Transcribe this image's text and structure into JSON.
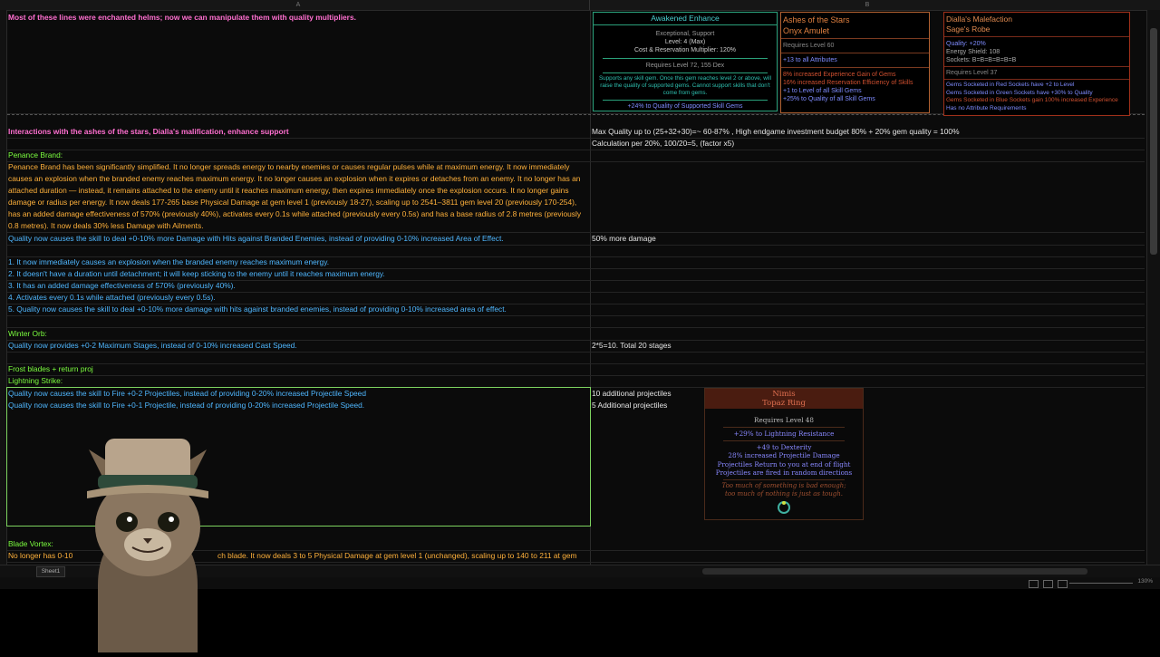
{
  "sheet": {
    "col_a": "A",
    "col_b": "B",
    "tab": "Sheet1",
    "zoom": "130%"
  },
  "rows": {
    "r1_a": "Most of these lines were enchanted helms; now we can manipulate them with quality multipliers.",
    "interactions_a": "Interactions with the ashes of the stars, Dialla's malification, enhance support",
    "interactions_b": "Max Quality up to (25+32+30)=~ 60-87% , High endgame investment budget 80% + 20% gem quality = 100%",
    "calc_b": "Calculation per 20%, 100/20=5, (factor x5)",
    "penance_title": "Penance Brand:",
    "penance_para": "Penance Brand has been significantly simplified. It no longer spreads energy to nearby enemies or causes regular pulses while at maximum energy. It now immediately causes an explosion when the branded enemy reaches maximum energy. It no longer causes an explosion when it expires or detaches from an enemy. It no longer has an attached duration — instead, it remains attached to the enemy until it reaches maximum energy, then expires immediately once the explosion occurs. It no longer gains damage or radius per energy. It now deals 177-265 base Physical Damage at gem level 1 (previously 18-27), scaling up to 2541–3811 gem level 20 (previously 170-254), has an added damage effectiveness of 570% (previously 40%), activates every 0.1s while attached (previously every 0.5s) and has a base radius of 2.8 metres (previously 0.8 metres). It now deals 30% less Damage with Ailments.",
    "penance_q_a": "Quality now causes the skill to deal +0-10% more Damage with Hits against Branded Enemies, instead of providing 0-10% increased Area of Effect.",
    "penance_q_b": "50% more damage",
    "l1": "1. It now immediately causes an explosion when the branded enemy reaches maximum energy.",
    "l2": "2. It doesn't have a duration until detachment; it will keep sticking to the enemy until it reaches maximum energy.",
    "l3": "3. It has an added damage effectiveness of 570% (previously 40%).",
    "l4": "4. Activates every 0.1s while attached (previously every 0.5s).",
    "l5": "5. Quality now causes the skill to deal +0-10% more damage with hits against branded enemies, instead of providing 0-10% increased area of effect.",
    "winter_title": "Winter Orb:",
    "winter_a": "Quality now provides +0-2 Maximum Stages, instead of 0-10% increased Cast Speed.",
    "winter_b": "2*5=10. Total 20 stages",
    "frost_title": "Frost blades + return proj",
    "lightning_title": "Lightning Strike:",
    "frost_q_a": "Quality now causes the skill to Fire +0-2 Projectiles, instead of providing 0-20% increased Projectile Speed",
    "frost_q_b": "10 additional projectiles",
    "lightning_q_a": "Quality now causes the skill to Fire +0-1 Projectile, instead of providing 0-20% increased Projectile Speed.",
    "lightning_q_b": "5 Additional projectiles",
    "blade_title": "Blade Vortex:",
    "blade_a_start": "No longer has 0-10",
    "blade_a_end": "ch blade. It now deals 3 to 5 Physical Damage at gem level 1 (unchanged), scaling up to 140 to 211 at gem"
  },
  "awakened": {
    "title": "Awakened Enhance",
    "tags": "Exceptional, Support",
    "level": "Level: 4 (Max)",
    "multiplier": "Cost & Reservation Multiplier: 120%",
    "requires": "Requires Level 72, 155 Dex",
    "desc": "Supports any skill gem. Once this gem reaches level 2 or above, will raise the quality of supported gems. Cannot support skills that don't come from gems.",
    "mod": "+24% to Quality of Supported Skill Gems"
  },
  "ashes": {
    "name": "Ashes of the Stars",
    "base": "Onyx Amulet",
    "requires": "Requires Level 60",
    "implicit": "+13 to all Attributes",
    "m1": "8% increased Experience Gain of Gems",
    "m2": "16% increased Reservation Efficiency of Skills",
    "m3": "+1 to Level of all Skill Gems",
    "m4": "+25% to Quality of all Skill Gems"
  },
  "diallas": {
    "name": "Dialla's Malefaction",
    "base": "Sage's Robe",
    "quality": "Quality: +20%",
    "es": "Energy Shield: 108",
    "sockets": "Sockets: B=B=B=B=B=B",
    "requires": "Requires Level 37",
    "m1": "Gems Socketed in Red Sockets have +2 to Level",
    "m2": "Gems Socketed in Green Sockets have +30% to Quality",
    "m3": "Gems Socketed in Blue Sockets gain 100% increased Experience",
    "m4": "Has no Attribute Requirements"
  },
  "nimis": {
    "name": "Nimis",
    "base": "Topaz Ring",
    "requires": "Requires Level 48",
    "m1": "+29% to Lightning Resistance",
    "m2": "+49 to Dexterity",
    "m3": "28% increased Projectile Damage",
    "m4": "Projectiles Return to you at end of flight",
    "m5": "Projectiles are fired in random directions",
    "f1": "Too much of something is bad enough;",
    "f2": "too much of nothing is just as tough."
  }
}
